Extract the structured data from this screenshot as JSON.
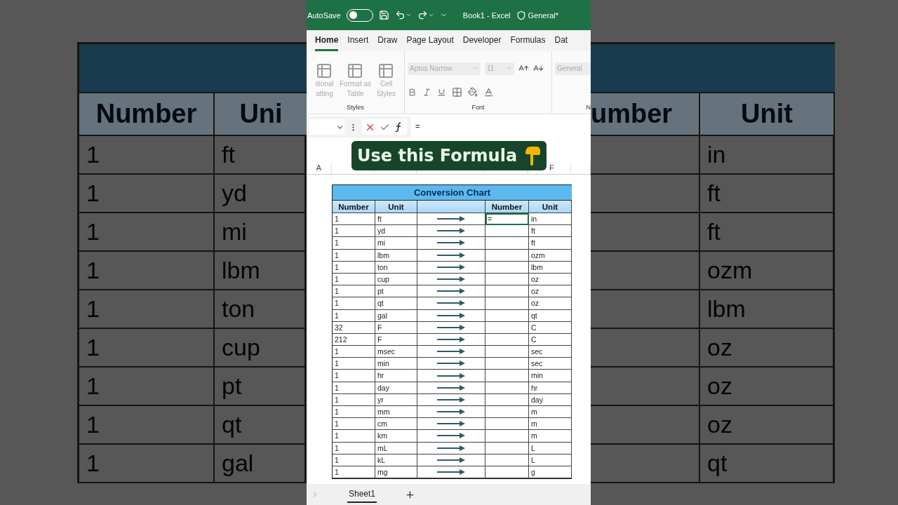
{
  "backdrop_left": {
    "headers": [
      "Number",
      "Uni"
    ],
    "rows": [
      [
        "1",
        "ft"
      ],
      [
        "1",
        "yd"
      ],
      [
        "1",
        "mi"
      ],
      [
        "1",
        "lbm"
      ],
      [
        "1",
        "ton"
      ],
      [
        "1",
        "cup"
      ],
      [
        "1",
        "pt"
      ],
      [
        "1",
        "qt"
      ],
      [
        "1",
        "gal"
      ]
    ]
  },
  "backdrop_right": {
    "headers": [
      "umber",
      "Unit"
    ],
    "rows": [
      "in",
      "ft",
      "ft",
      "ozm",
      "lbm",
      "oz",
      "oz",
      "oz",
      "qt"
    ]
  },
  "title_bar": {
    "autosave_label": "AutoSave",
    "autosave_on": false,
    "title": "Book1  -  Excel",
    "sensitivity": "General*"
  },
  "ribbon_tabs": [
    {
      "label": "Home",
      "selected": true
    },
    {
      "label": "Insert",
      "selected": false
    },
    {
      "label": "Draw",
      "selected": false
    },
    {
      "label": "Page Layout",
      "selected": false
    },
    {
      "label": "Developer",
      "selected": false
    },
    {
      "label": "Formulas",
      "selected": false
    },
    {
      "label": "Dat",
      "selected": false
    }
  ],
  "ribbon": {
    "styles_buttons": [
      [
        "itional",
        "atting"
      ],
      [
        "Format as",
        "Table"
      ],
      [
        "Cell",
        "Styles"
      ]
    ],
    "styles_label": "Styles",
    "font_name": "Aptos Narrow",
    "font_size": "11",
    "font_label": "Font",
    "number_format": "General",
    "number_label": "N"
  },
  "formula_bar": {
    "formula": "="
  },
  "caption": "Use this Formula",
  "column_headers": [
    "A",
    "F"
  ],
  "chart": {
    "title": "Conversion Chart",
    "headers": [
      "Number",
      "Unit",
      "Number",
      "Unit"
    ],
    "rows": [
      {
        "number": "1",
        "unit": "ft",
        "result": "=",
        "selected": true,
        "to_unit": "in"
      },
      {
        "number": "1",
        "unit": "yd",
        "selected": false,
        "to_unit": "ft"
      },
      {
        "number": "1",
        "unit": "mi",
        "selected": false,
        "to_unit": "ft"
      },
      {
        "number": "1",
        "unit": "lbm",
        "selected": false,
        "to_unit": "ozm"
      },
      {
        "number": "1",
        "unit": "ton",
        "selected": false,
        "to_unit": "lbm"
      },
      {
        "number": "1",
        "unit": "cup",
        "selected": false,
        "to_unit": "oz"
      },
      {
        "number": "1",
        "unit": "pt",
        "selected": false,
        "to_unit": "oz"
      },
      {
        "number": "1",
        "unit": "qt",
        "selected": false,
        "to_unit": "oz"
      },
      {
        "number": "1",
        "unit": "gal",
        "selected": false,
        "to_unit": "qt"
      },
      {
        "number": "32",
        "unit": "F",
        "selected": false,
        "to_unit": "C"
      },
      {
        "number": "212",
        "unit": "F",
        "selected": false,
        "to_unit": "C"
      },
      {
        "number": "1",
        "unit": "msec",
        "selected": false,
        "to_unit": "sec"
      },
      {
        "number": "1",
        "unit": "min",
        "selected": false,
        "to_unit": "sec"
      },
      {
        "number": "1",
        "unit": "hr",
        "selected": false,
        "to_unit": "min"
      },
      {
        "number": "1",
        "unit": "day",
        "selected": false,
        "to_unit": "hr"
      },
      {
        "number": "1",
        "unit": "yr",
        "selected": false,
        "to_unit": "day"
      },
      {
        "number": "1",
        "unit": "mm",
        "selected": false,
        "to_unit": "m"
      },
      {
        "number": "1",
        "unit": "cm",
        "selected": false,
        "to_unit": "m"
      },
      {
        "number": "1",
        "unit": "km",
        "selected": false,
        "to_unit": "m"
      },
      {
        "number": "1",
        "unit": "mL",
        "selected": false,
        "to_unit": "L"
      },
      {
        "number": "1",
        "unit": "kL",
        "selected": false,
        "to_unit": "L"
      },
      {
        "number": "1",
        "unit": "mg",
        "selected": false,
        "to_unit": "g"
      }
    ]
  },
  "sheet_tabs": [
    {
      "label": "Sheet1",
      "selected": true
    }
  ]
}
